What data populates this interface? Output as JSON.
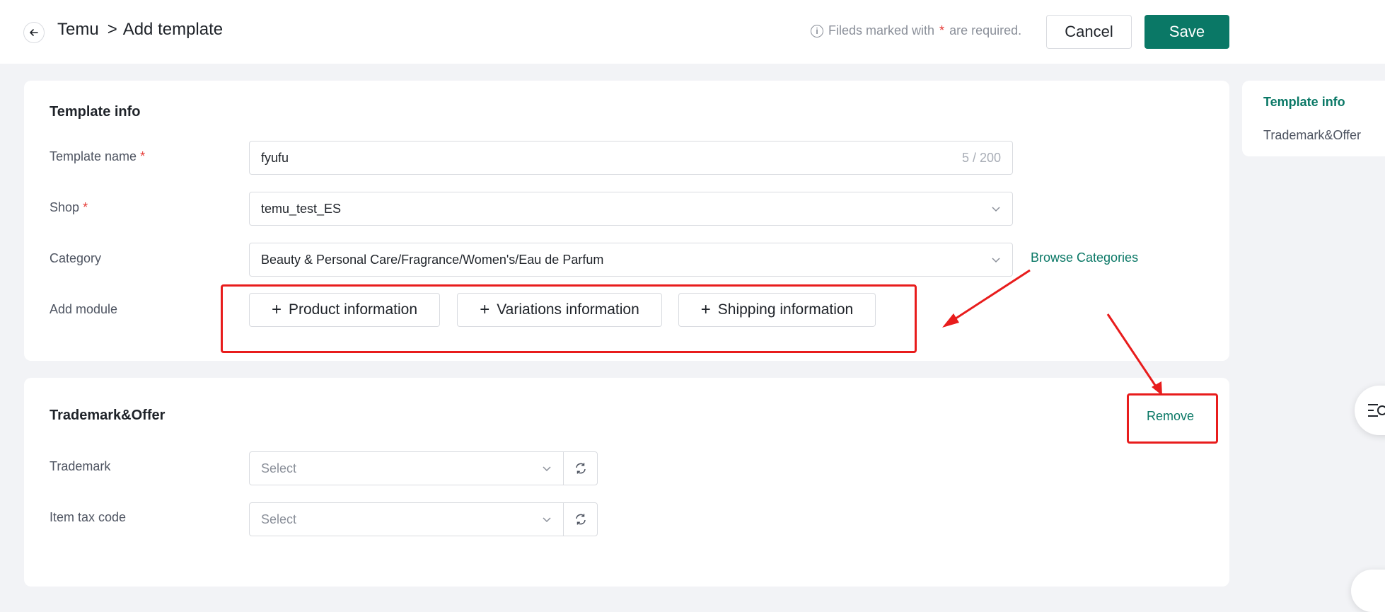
{
  "header": {
    "breadcrumb_root": "Temu",
    "breadcrumb_sep": ">",
    "page_title": "Add template",
    "required_note_prefix": "Fileds marked with",
    "required_star": "*",
    "required_note_suffix": "are required.",
    "cancel_label": "Cancel",
    "save_label": "Save"
  },
  "template_info": {
    "title": "Template info",
    "template_name_label": "Template name",
    "template_name_value": "fyufu",
    "template_name_count": "5 / 200",
    "shop_label": "Shop",
    "shop_value": "temu_test_ES",
    "category_label": "Category",
    "category_value": "Beauty & Personal Care/Fragrance/Women's/Eau de Parfum",
    "browse_label": "Browse Categories",
    "add_module_label": "Add module",
    "modules": [
      {
        "label": "Product information"
      },
      {
        "label": "Variations information"
      },
      {
        "label": "Shipping information"
      }
    ]
  },
  "trademark_offer": {
    "title": "Trademark&Offer",
    "remove_label": "Remove",
    "trademark_label": "Trademark",
    "trademark_placeholder": "Select",
    "tax_code_label": "Item tax code",
    "tax_code_placeholder": "Select"
  },
  "side_nav": {
    "items": [
      {
        "label": "Template info"
      },
      {
        "label": "Trademark&Offer"
      }
    ]
  },
  "icons": {
    "back": "arrow-left-icon",
    "info": "info-icon",
    "chevron": "chevron-down-icon",
    "refresh": "refresh-icon",
    "plus": "plus-icon"
  },
  "colors": {
    "accent": "#0a7866",
    "annotation": "#e81c1c",
    "required": "#e53935"
  }
}
